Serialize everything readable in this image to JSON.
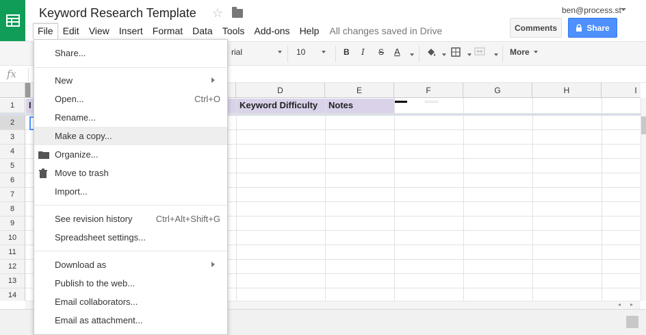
{
  "header": {
    "title": "Keyword Research Template",
    "user_email": "ben@process.st",
    "comments_label": "Comments",
    "share_label": "Share",
    "saved_status": "All changes saved in Drive"
  },
  "menubar": [
    "File",
    "Edit",
    "View",
    "Insert",
    "Format",
    "Data",
    "Tools",
    "Add-ons",
    "Help"
  ],
  "toolbar": {
    "font": "rial",
    "font_size": "10",
    "more_label": "More",
    "text_color": "#000000"
  },
  "formula_bar": {
    "fx_label": "fx"
  },
  "columns": [
    "D",
    "E",
    "F",
    "G",
    "H",
    "I"
  ],
  "rows": [
    "1",
    "2",
    "3",
    "4",
    "5",
    "6",
    "7",
    "8",
    "9",
    "10",
    "11",
    "12",
    "13",
    "14"
  ],
  "header_cells": {
    "d1": "Keyword Difficulty",
    "e1": "Notes",
    "b1_partial": "I"
  },
  "file_menu": {
    "share": "Share...",
    "new": "New",
    "open": "Open...",
    "open_shortcut": "Ctrl+O",
    "rename": "Rename...",
    "make_copy": "Make a copy...",
    "organize": "Organize...",
    "move_to_trash": "Move to trash",
    "import": "Import...",
    "revision_history": "See revision history",
    "revision_shortcut": "Ctrl+Alt+Shift+G",
    "spreadsheet_settings": "Spreadsheet settings...",
    "download_as": "Download as",
    "publish": "Publish to the web...",
    "email_collaborators": "Email collaborators...",
    "email_attachment": "Email as attachment..."
  },
  "colors": {
    "brand_green": "#0f9d58",
    "share_blue": "#4d90fe",
    "header_fill": "#d9d2e9"
  }
}
